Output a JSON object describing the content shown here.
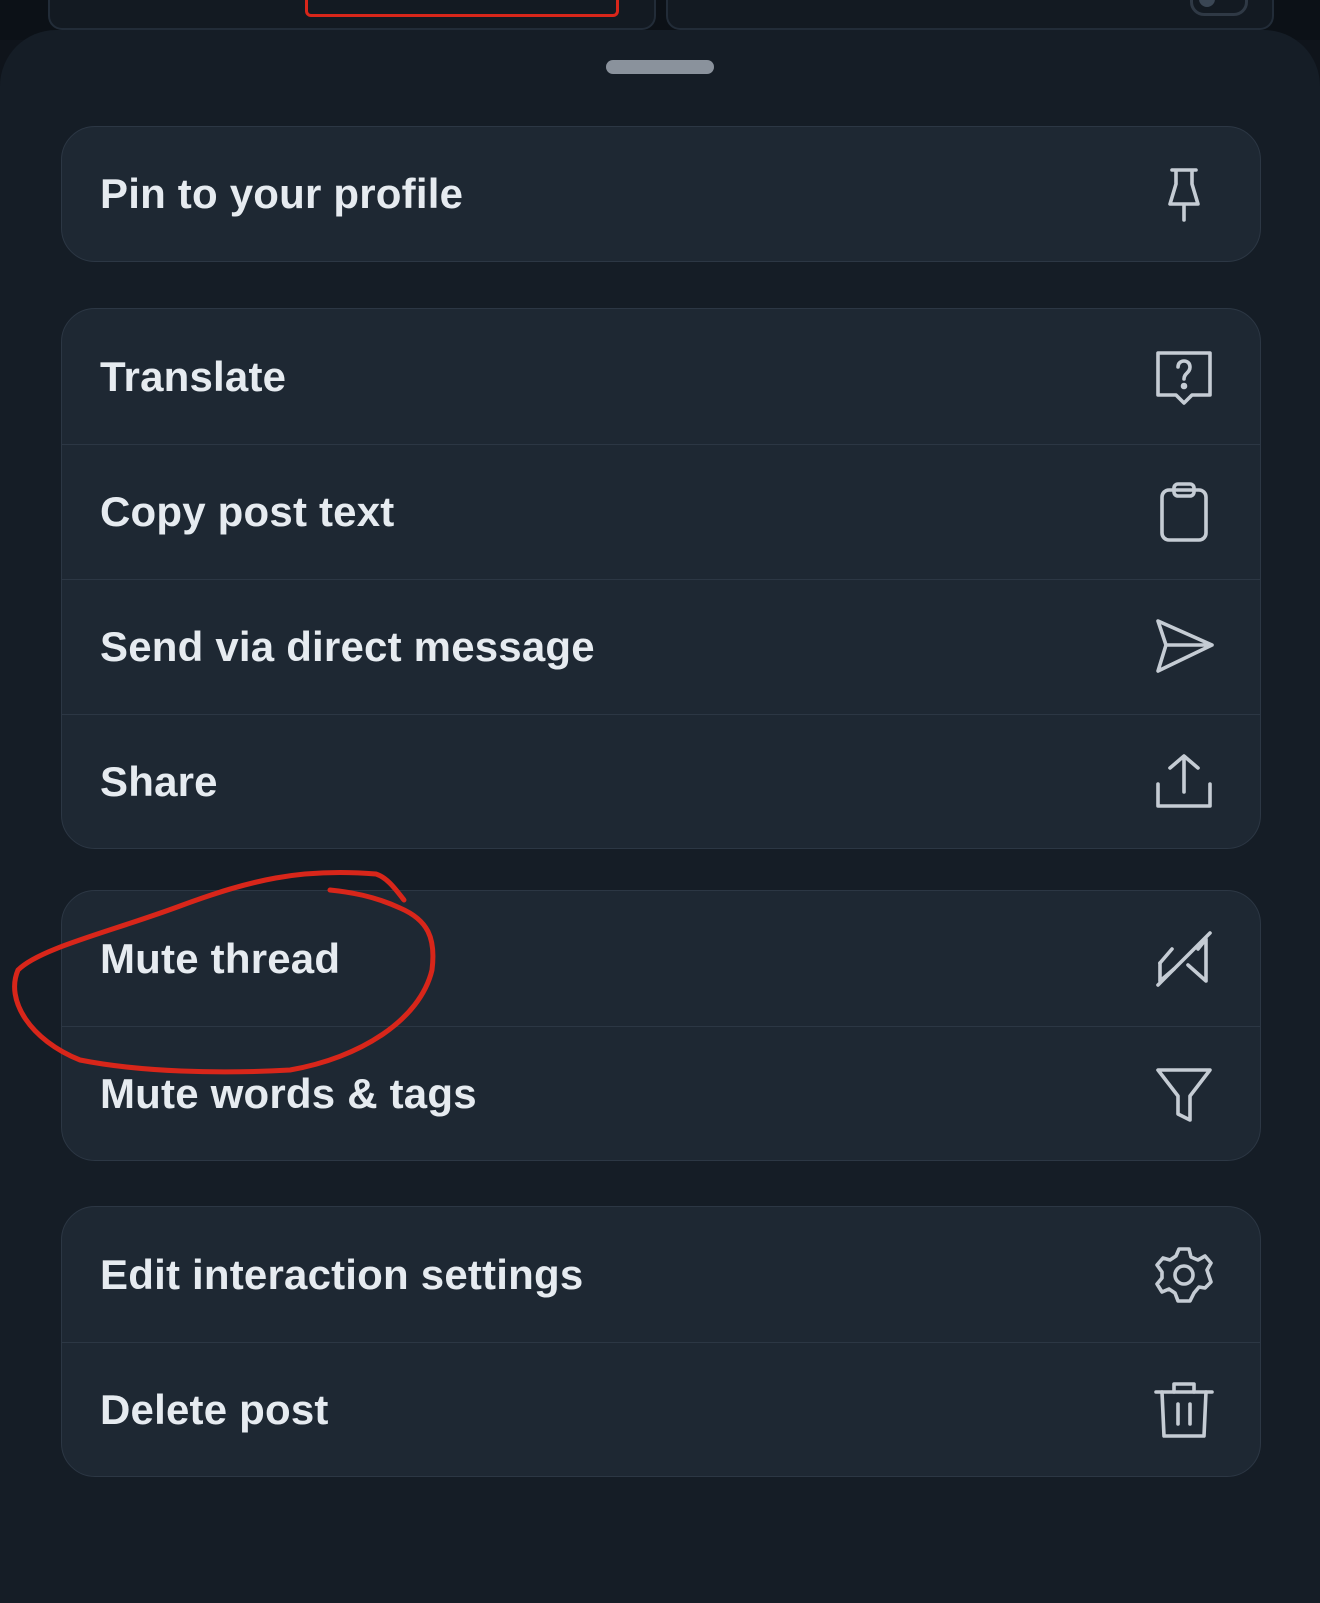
{
  "menu": {
    "group_pin": [
      {
        "label": "Pin to your profile",
        "icon": "pin-icon"
      }
    ],
    "group_post": [
      {
        "label": "Translate",
        "icon": "translate-icon"
      },
      {
        "label": "Copy post text",
        "icon": "clipboard-icon"
      },
      {
        "label": "Send via direct message",
        "icon": "send-icon"
      },
      {
        "label": "Share",
        "icon": "share-icon"
      }
    ],
    "group_mute": [
      {
        "label": "Mute thread",
        "icon": "mute-icon"
      },
      {
        "label": "Mute words & tags",
        "icon": "filter-icon"
      }
    ],
    "group_owner": [
      {
        "label": "Edit interaction settings",
        "icon": "gear-icon"
      },
      {
        "label": "Delete post",
        "icon": "trash-icon"
      }
    ]
  },
  "colors": {
    "sheet_background": "#151d26",
    "item_background": "#1e2833",
    "text": "#e6ebf0",
    "icon": "#c5ccd4",
    "annotation": "#d8261a"
  }
}
